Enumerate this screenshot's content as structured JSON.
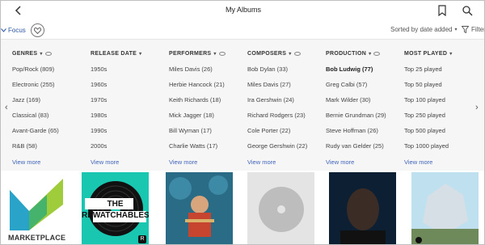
{
  "header": {
    "title": "My Albums"
  },
  "toolbar": {
    "focus_label": "Focus",
    "sort_label": "Sorted by date added",
    "filter_label": "Filter"
  },
  "columns": [
    {
      "title": "GENRES",
      "items": [
        "Pop/Rock (809)",
        "Electronic (255)",
        "Jazz (169)",
        "Classical (83)",
        "Avant-Garde (65)",
        "R&B (58)"
      ],
      "active": -1
    },
    {
      "title": "RELEASE DATE",
      "items": [
        "1950s",
        "1960s",
        "1970s",
        "1980s",
        "1990s",
        "2000s"
      ],
      "active": -1
    },
    {
      "title": "PERFORMERS",
      "items": [
        "Miles Davis (26)",
        "Herbie Hancock (21)",
        "Keith Richards (18)",
        "Mick Jagger (18)",
        "Bill Wyman (17)",
        "Charlie Watts (17)"
      ],
      "active": -1
    },
    {
      "title": "COMPOSERS",
      "items": [
        "Bob Dylan (33)",
        "Miles Davis (27)",
        "Ira Gershwin (24)",
        "Richard Rodgers (23)",
        "Cole Porter (22)",
        "George Gershwin (22)"
      ],
      "active": -1
    },
    {
      "title": "PRODUCTION",
      "items": [
        "Bob Ludwig (77)",
        "Greg Calbi (57)",
        "Mark Wilder (30)",
        "Bernie Grundman (29)",
        "Steve Hoffman (26)",
        "Rudy van Gelder (25)"
      ],
      "active": 0
    },
    {
      "title": "MOST PLAYED",
      "items": [
        "Top 25 played",
        "Top 50 played",
        "Top 100 played",
        "Top 250 played",
        "Top 500 played",
        "Top 1000 played"
      ],
      "active": -1
    }
  ],
  "view_more_label": "View more",
  "albums": [
    {
      "art_text": "MARKETPLACE"
    },
    {
      "art_text": "THE REWATCHABLES",
      "badge": "R"
    },
    {
      "art_text": ""
    },
    {
      "art_text": ""
    },
    {
      "art_text": ""
    },
    {
      "art_text": ""
    }
  ]
}
